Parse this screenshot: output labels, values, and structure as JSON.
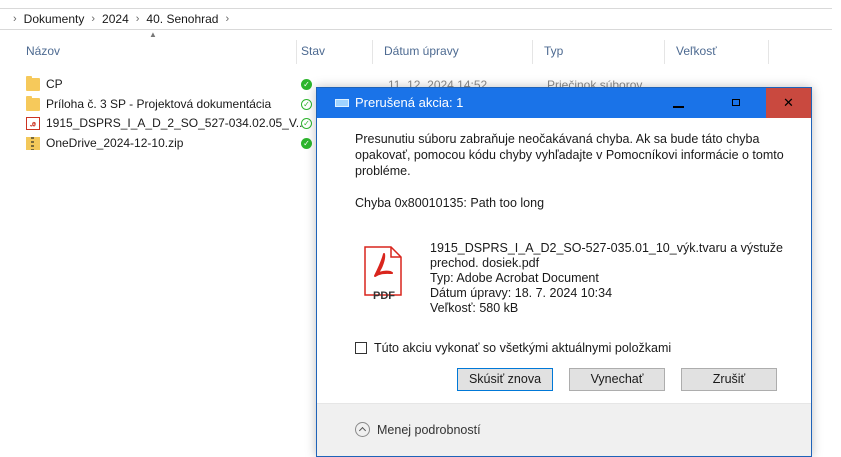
{
  "breadcrumb": [
    "Dokumenty",
    "2024",
    "40. Senohrad"
  ],
  "columns": {
    "name": "Názov",
    "status": "Stav",
    "modified": "Dátum úpravy",
    "type": "Typ",
    "size": "Veľkosť"
  },
  "files": [
    {
      "name": "CP",
      "date": "11. 12. 2024 14:52",
      "type": "Priečinok súborov"
    },
    {
      "name": "Príloha č. 3 SP - Projektová dokumentácia"
    },
    {
      "name": "1915_DSPRS_I_A_D_2_SO_527-034.02.05_V..."
    },
    {
      "name": "OneDrive_2024-12-10.zip"
    }
  ],
  "dialog": {
    "title": "Prerušená akcia: 1",
    "message": "Presunutiu súboru zabraňuje neočakávaná chyba. Ak sa bude táto chyba opakovať, pomocou kódu chyby vyhľadajte v Pomocníkovi informácie o tomto probléme.",
    "error": "Chyba 0x80010135: Path too long",
    "file": {
      "name_line1": "1915_DSPRS_I_A_D2_SO-527-035.01_10_výk.tvaru a výstuže",
      "name_line2": "prechod. dosiek.pdf",
      "type": "Typ: Adobe Acrobat Document",
      "modified": "Dátum úpravy: 18. 7. 2024 10:34",
      "size": "Veľkosť: 580 kB",
      "icon_label": "PDF"
    },
    "checkbox_label": "Túto akciu vykonať so všetkými aktuálnymi položkami",
    "buttons": {
      "retry": "Skúsiť znova",
      "skip": "Vynechať",
      "cancel": "Zrušiť"
    },
    "details_toggle": "Menej podrobností"
  },
  "colors": {
    "titlebar": "#1a73e8",
    "close": "#c9493f",
    "status_ok": "#2db52d",
    "pdf_red": "#d9251d"
  }
}
